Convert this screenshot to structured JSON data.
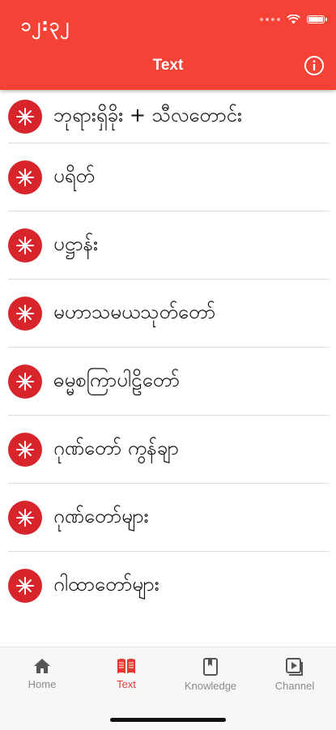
{
  "status_bar": {
    "time": "၁၂:၃၂"
  },
  "app_bar": {
    "title": "Text"
  },
  "list": {
    "items": [
      {
        "label": "ဘုရားရှိခိုး + သီလတောင်း"
      },
      {
        "label": "ပရိတ်"
      },
      {
        "label": "ပဋ္ဌာန်း"
      },
      {
        "label": "မဟာသမယသုတ်တော်"
      },
      {
        "label": "ဓမ္မစကြာပါဠိတော်"
      },
      {
        "label": "ဂုဏ်တော် ကွန်ချာ"
      },
      {
        "label": "ဂုဏ်တော်များ"
      },
      {
        "label": "ဂါထာတော်များ"
      }
    ]
  },
  "tabs": [
    {
      "label": "Home",
      "icon": "home-icon"
    },
    {
      "label": "Text",
      "icon": "book-icon",
      "active": true
    },
    {
      "label": "Knowledge",
      "icon": "bookmark-book-icon"
    },
    {
      "label": "Channel",
      "icon": "video-play-icon"
    }
  ],
  "colors": {
    "accent": "#f44336",
    "icon_bg": "#d8252c",
    "active_tab": "#e53935",
    "inactive_tab": "#8a8a8a"
  }
}
